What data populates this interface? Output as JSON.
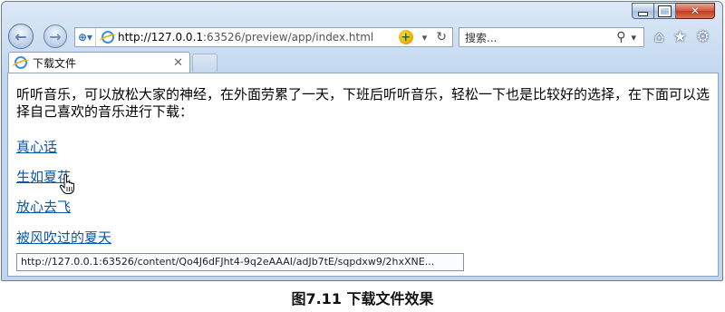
{
  "address_bar": {
    "url_host": "http://127.0.0.1",
    "url_rest": ":63526/preview/app/index.html"
  },
  "search_box": {
    "placeholder": "搜索..."
  },
  "tab": {
    "title": "下载文件"
  },
  "page": {
    "intro": "听听音乐，可以放松大家的神经，在外面劳累了一天，下班后听听音乐，轻松一下也是比较好的选择，在下面可以选择自己喜欢的音乐进行下载：",
    "songs": [
      "真心话",
      "生如夏花",
      "放心去飞",
      "被风吹过的夏天"
    ]
  },
  "status_tip": "http://127.0.0.1:63526/content/Qo4J6dFJht4-9q2eAAAI/adJb7tE/sqpdxw9/2hxXNE...",
  "figure_caption": "图7.11 下载文件效果",
  "colors": {
    "link": "#0a58a8",
    "chrome": "#c9dcf1"
  },
  "icons": {
    "back": "back-arrow-icon",
    "forward": "forward-arrow-icon",
    "home": "home-icon",
    "favorites": "star-icon",
    "tools": "gear-icon",
    "refresh": "refresh-icon",
    "search": "magnifier-icon",
    "ie": "ie-logo-icon",
    "compatibility": "compatibility-view-icon"
  }
}
